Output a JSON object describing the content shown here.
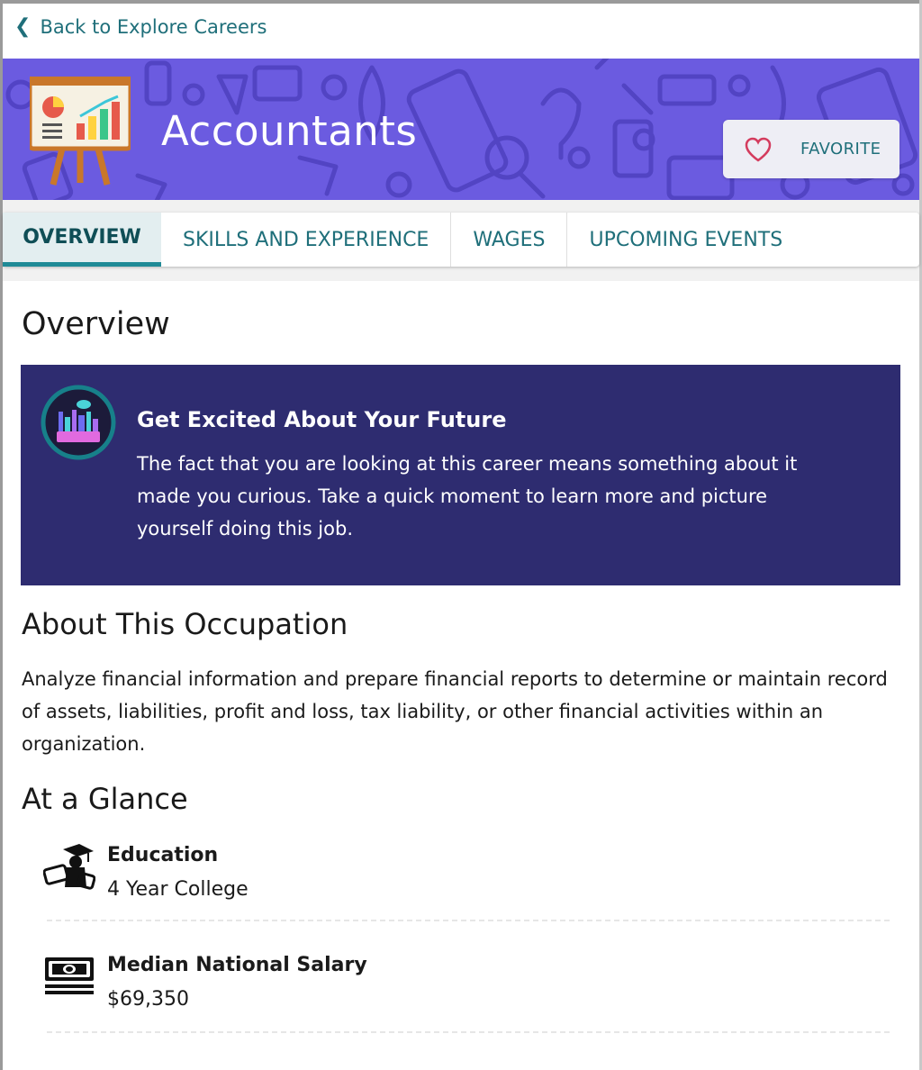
{
  "nav": {
    "back_label": "Back to Explore Careers",
    "back_icon": "chevron-left-icon"
  },
  "banner": {
    "title": "Accountants",
    "favorite_label": "FAVORITE",
    "colors": {
      "background": "#6b5be0",
      "accent": "#1f6f7a"
    }
  },
  "tabs": [
    {
      "label": "OVERVIEW",
      "active": true
    },
    {
      "label": "SKILLS AND EXPERIENCE",
      "active": false
    },
    {
      "label": "WAGES",
      "active": false
    },
    {
      "label": "UPCOMING EVENTS",
      "active": false
    }
  ],
  "overview": {
    "title": "Overview",
    "callout": {
      "heading": "Get Excited About Your Future",
      "body": "The fact that you are looking at this career means something about it made you curious. Take a quick moment to learn more and picture yourself doing this job."
    }
  },
  "about": {
    "title": "About This Occupation",
    "body": "Analyze financial information and prepare financial reports to determine or maintain record of assets, liabilities, profit and loss, tax liability, or other financial activities within an organization."
  },
  "glance": {
    "title": "At a Glance",
    "items": [
      {
        "label": "Education",
        "value": "4 Year College",
        "icon": "graduation-icon"
      },
      {
        "label": "Median National Salary",
        "value": "$69,350",
        "icon": "money-icon"
      }
    ]
  }
}
